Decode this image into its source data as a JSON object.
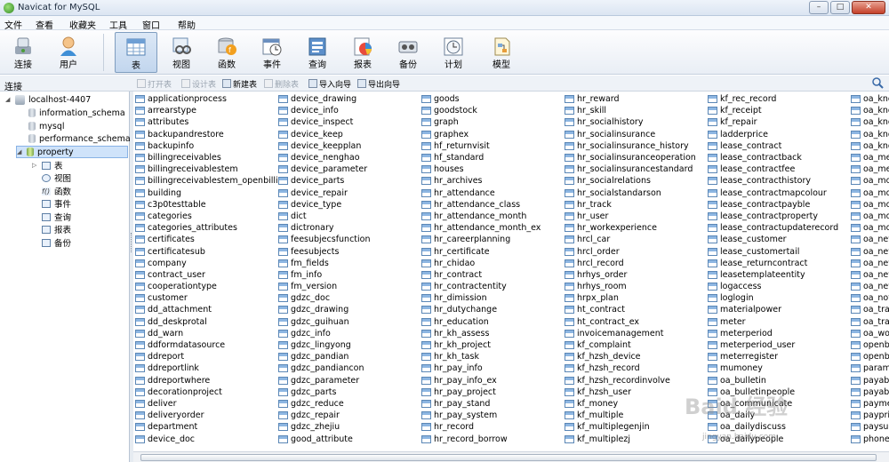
{
  "window": {
    "title": "Navicat for MySQL"
  },
  "menu": [
    "文件",
    "查看",
    "收藏夹",
    "工具",
    "窗口",
    "帮助"
  ],
  "toolbar": [
    {
      "label": "连接",
      "icon": "connection-icon"
    },
    {
      "label": "用户",
      "icon": "user-icon"
    },
    {
      "label": "表",
      "icon": "table-icon",
      "active": true
    },
    {
      "label": "视图",
      "icon": "view-icon"
    },
    {
      "label": "函数",
      "icon": "function-icon"
    },
    {
      "label": "事件",
      "icon": "event-icon"
    },
    {
      "label": "查询",
      "icon": "query-icon"
    },
    {
      "label": "报表",
      "icon": "report-icon"
    },
    {
      "label": "备份",
      "icon": "backup-icon"
    },
    {
      "label": "计划",
      "icon": "schedule-icon"
    },
    {
      "label": "模型",
      "icon": "model-icon"
    }
  ],
  "connection_header": "连接",
  "object_toolbar": [
    {
      "label": "打开表",
      "enabled": false
    },
    {
      "label": "设计表",
      "enabled": false
    },
    {
      "label": "新建表",
      "enabled": true
    },
    {
      "label": "删除表",
      "enabled": false
    },
    {
      "label": "导入向导",
      "enabled": true
    },
    {
      "label": "导出向导",
      "enabled": true
    }
  ],
  "tree": {
    "connection": "localhost-4407",
    "databases": [
      "information_schema",
      "mysql",
      "performance_schema",
      "property"
    ],
    "selected_database": "property",
    "children": [
      "表",
      "视图",
      "函数",
      "事件",
      "查询",
      "报表",
      "备份"
    ]
  },
  "tables": [
    [
      "applicationprocess",
      "arrearstype",
      "attributes",
      "backupandrestore",
      "backupinfo",
      "billingreceivables",
      "billingreceivablestem",
      "billingreceivablestem_openbilling",
      "building",
      "c3p0testtable",
      "categories",
      "categories_attributes",
      "certificates",
      "certificatesub",
      "company",
      "contract_user",
      "cooperationtype",
      "customer",
      "dd_attachment",
      "dd_deskprotal",
      "dd_warn",
      "ddformdatasource",
      "ddreport",
      "ddreportlink",
      "ddreportwhere",
      "decorationproject",
      "deliver",
      "deliveryorder",
      "department",
      "device_doc"
    ],
    [
      "device_drawing",
      "device_info",
      "device_inspect",
      "device_keep",
      "device_keepplan",
      "device_nenghao",
      "device_parameter",
      "device_parts",
      "device_repair",
      "device_type",
      "dict",
      "dictronary",
      "feesubjecsfunction",
      "feesubjects",
      "fm_fields",
      "fm_info",
      "fm_version",
      "gdzc_doc",
      "gdzc_drawing",
      "gdzc_guihuan",
      "gdzc_info",
      "gdzc_lingyong",
      "gdzc_pandian",
      "gdzc_pandiancon",
      "gdzc_parameter",
      "gdzc_parts",
      "gdzc_reduce",
      "gdzc_repair",
      "gdzc_zhejiu",
      "good_attribute"
    ],
    [
      "goods",
      "goodstock",
      "graph",
      "graphex",
      "hf_returnvisit",
      "hf_standard",
      "houses",
      "hr_archives",
      "hr_attendance",
      "hr_attendance_class",
      "hr_attendance_month",
      "hr_attendance_month_ex",
      "hr_careerplanning",
      "hr_certificate",
      "hr_chidao",
      "hr_contract",
      "hr_contractentity",
      "hr_dimission",
      "hr_dutychange",
      "hr_education",
      "hr_kh_assess",
      "hr_kh_project",
      "hr_kh_task",
      "hr_pay_info",
      "hr_pay_info_ex",
      "hr_pay_project",
      "hr_pay_stand",
      "hr_pay_system",
      "hr_record",
      "hr_record_borrow"
    ],
    [
      "hr_reward",
      "hr_skill",
      "hr_socialhistory",
      "hr_socialinsurance",
      "hr_socialinsurance_history",
      "hr_socialinsuranceoperation",
      "hr_socialinsurancestandard",
      "hr_socialrelations",
      "hr_socialstandarson",
      "hr_track",
      "hr_user",
      "hr_workexperience",
      "hrcl_car",
      "hrcl_order",
      "hrcl_record",
      "hrhys_order",
      "hrhys_room",
      "hrpx_plan",
      "ht_contract",
      "ht_contract_ex",
      "invoicemanagement",
      "kf_complaint",
      "kf_hzsh_device",
      "kf_hzsh_record",
      "kf_hzsh_recordinvolve",
      "kf_hzsh_user",
      "kf_money",
      "kf_multiple",
      "kf_multiplegenjin",
      "kf_multiplezj"
    ],
    [
      "kf_rec_record",
      "kf_receipt",
      "kf_repair",
      "ladderprice",
      "lease_contract",
      "lease_contractback",
      "lease_contractfee",
      "lease_contracthistory",
      "lease_contractmapcolour",
      "lease_contractpayble",
      "lease_contractproperty",
      "lease_contractupdaterecord",
      "lease_customer",
      "lease_customertail",
      "lease_returncontract",
      "leasetemplateentity",
      "logaccess",
      "loglogin",
      "materialpower",
      "meter",
      "meterperiod",
      "meterperiod_user",
      "meterregister",
      "mumoney",
      "oa_bulletin",
      "oa_bulletinpeople",
      "oa_communicate",
      "oa_daily",
      "oa_dailydiscuss",
      "oa_dailypeople"
    ],
    [
      "oa_kno",
      "oa_kno",
      "oa_kno",
      "oa_kno",
      "oa_kno",
      "oa_me",
      "oa_me",
      "oa_mo",
      "oa_mo",
      "oa_mo",
      "oa_mo",
      "oa_mo",
      "oa_nev",
      "oa_nev",
      "oa_nev",
      "oa_nev",
      "oa_nev",
      "oa_not",
      "oa_trai",
      "oa_trai",
      "oa_wo",
      "openb",
      "openb",
      "param",
      "payabl",
      "payabl",
      "payme",
      "paypri",
      "paysub",
      "phone"
    ]
  ],
  "watermark": {
    "text": "Baid 经验",
    "sub": "jingyan.baidu.com"
  }
}
